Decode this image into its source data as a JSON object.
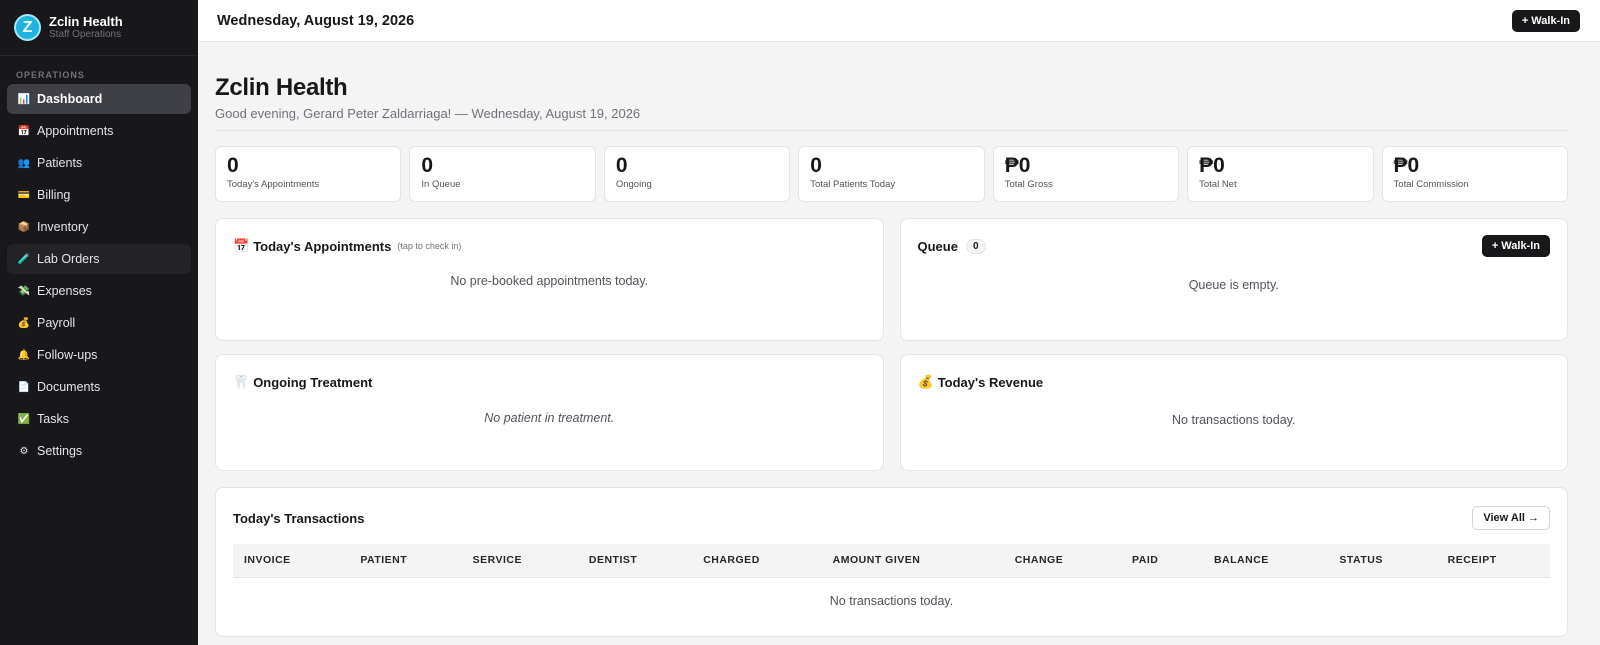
{
  "brand": {
    "logo_letter": "Z",
    "name": "Zclin Health",
    "subtitle": "Staff Operations"
  },
  "sidebar": {
    "section_label": "OPERATIONS",
    "items": [
      {
        "label": "Dashboard",
        "icon": "chart-icon",
        "glyph": "📊",
        "active": true
      },
      {
        "label": "Appointments",
        "icon": "calendar-icon",
        "glyph": "📅"
      },
      {
        "label": "Patients",
        "icon": "people-icon",
        "glyph": "👥"
      },
      {
        "label": "Billing",
        "icon": "card-icon",
        "glyph": "💳"
      },
      {
        "label": "Inventory",
        "icon": "box-icon",
        "glyph": "📦"
      },
      {
        "label": "Lab Orders",
        "icon": "test-tube-icon",
        "glyph": "🧪",
        "hover": true
      },
      {
        "label": "Expenses",
        "icon": "money-icon",
        "glyph": "💸"
      },
      {
        "label": "Payroll",
        "icon": "money-bag-icon",
        "glyph": "💰"
      },
      {
        "label": "Follow-ups",
        "icon": "bell-icon",
        "glyph": "🔔"
      },
      {
        "label": "Documents",
        "icon": "document-icon",
        "glyph": "📄"
      },
      {
        "label": "Tasks",
        "icon": "check-icon",
        "glyph": "✅"
      },
      {
        "label": "Settings",
        "icon": "gear-icon",
        "glyph": "⚙"
      }
    ]
  },
  "topbar": {
    "date": "Wednesday, August 19, 2026",
    "walkin_label": "+ Walk-In"
  },
  "header": {
    "title": "Zclin Health",
    "greeting": "Good evening, Gerard Peter Zaldarriaga! — Wednesday, August 19, 2026"
  },
  "stats": [
    {
      "value": "0",
      "label": "Today's Appointments"
    },
    {
      "value": "0",
      "label": "In Queue"
    },
    {
      "value": "0",
      "label": "Ongoing"
    },
    {
      "value": "0",
      "label": "Total Patients Today"
    },
    {
      "value": "₱0",
      "label": "Total Gross"
    },
    {
      "value": "₱0",
      "label": "Total Net"
    },
    {
      "value": "₱0",
      "label": "Total Commission"
    }
  ],
  "appointments_card": {
    "icon_glyph": "📅",
    "title": "Today's Appointments",
    "note": "(tap to check in)",
    "empty": "No pre-booked appointments today."
  },
  "queue_card": {
    "title": "Queue",
    "count": "0",
    "walkin_label": "+ Walk-In",
    "empty": "Queue is empty."
  },
  "treatment_card": {
    "icon_glyph": "🦷",
    "title": "Ongoing Treatment",
    "empty": "No patient in treatment."
  },
  "revenue_card": {
    "icon_glyph": "💰",
    "title": "Today's Revenue",
    "empty": "No transactions today."
  },
  "transactions": {
    "title": "Today's Transactions",
    "view_all_label": "View All →",
    "columns": [
      "INVOICE",
      "PATIENT",
      "SERVICE",
      "DENTIST",
      "CHARGED",
      "AMOUNT GIVEN",
      "CHANGE",
      "PAID",
      "BALANCE",
      "STATUS",
      "RECEIPT"
    ],
    "empty": "No transactions today."
  },
  "colors": {
    "sidebar_bg": "#18181b",
    "active_item_bg": "#3f3f46",
    "accent_logo": "#1fb3e0",
    "button_dark": "#18181b"
  }
}
